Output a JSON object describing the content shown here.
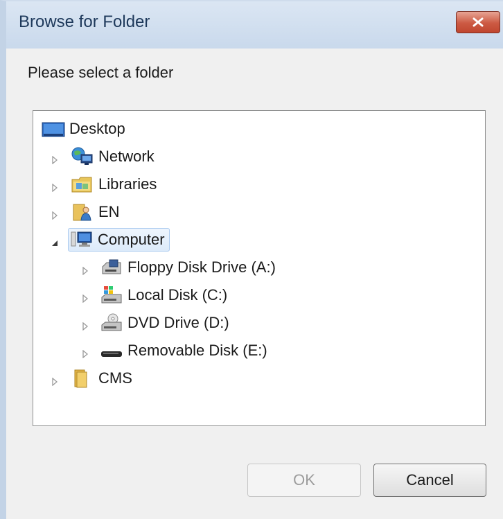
{
  "dialog": {
    "title": "Browse for Folder",
    "prompt": "Please select a folder"
  },
  "tree": {
    "items": [
      {
        "label": "Desktop",
        "icon": "desktop-icon",
        "level": 0,
        "expander": "none"
      },
      {
        "label": "Network",
        "icon": "network-icon",
        "level": 1,
        "expander": "collapsed"
      },
      {
        "label": "Libraries",
        "icon": "libraries-icon",
        "level": 1,
        "expander": "collapsed"
      },
      {
        "label": "EN",
        "icon": "user-folder-icon",
        "level": 1,
        "expander": "collapsed"
      },
      {
        "label": "Computer",
        "icon": "computer-icon",
        "level": 1,
        "expander": "expanded",
        "selected": true
      },
      {
        "label": "Floppy Disk Drive (A:)",
        "icon": "floppy-drive-icon",
        "level": 2,
        "expander": "collapsed"
      },
      {
        "label": "Local Disk (C:)",
        "icon": "local-disk-icon",
        "level": 2,
        "expander": "collapsed"
      },
      {
        "label": "DVD Drive (D:)",
        "icon": "dvd-drive-icon",
        "level": 2,
        "expander": "collapsed"
      },
      {
        "label": "Removable Disk (E:)",
        "icon": "removable-disk-icon",
        "level": 2,
        "expander": "collapsed"
      },
      {
        "label": "CMS",
        "icon": "folder-icon",
        "level": 1,
        "expander": "collapsed"
      }
    ]
  },
  "buttons": {
    "ok_label": "OK",
    "ok_enabled": false,
    "cancel_label": "Cancel"
  },
  "colors": {
    "title_text": "#1e395b",
    "close_button": "#c0462f",
    "selection_border": "#a9c9ef"
  }
}
